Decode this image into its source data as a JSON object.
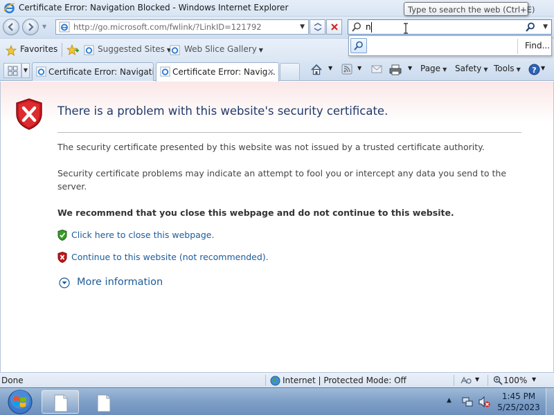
{
  "window": {
    "title": "Certificate Error: Navigation Blocked - Windows Internet Explorer"
  },
  "nav": {
    "url": "http://go.microsoft.com/fwlink/?LinkID=121792"
  },
  "search": {
    "value": "n",
    "tooltip": "Type to search the web (Ctrl+E)",
    "find_label": "Find..."
  },
  "favorites_bar": {
    "favorites_label": "Favorites",
    "suggested_sites": "Suggested Sites",
    "web_slice_gallery": "Web Slice Gallery"
  },
  "tabs": [
    {
      "label": "Certificate Error: Navigatio...",
      "active": false
    },
    {
      "label": "Certificate Error: Navig...",
      "active": true
    }
  ],
  "command_bar": {
    "page": "Page",
    "safety": "Safety",
    "tools": "Tools"
  },
  "content": {
    "heading": "There is a problem with this website's security certificate.",
    "para1": "The security certificate presented by this website was not issued by a trusted certificate authority.",
    "para2": "Security certificate problems may indicate an attempt to fool you or intercept any data you send to the server.",
    "recommendation": "We recommend that you close this webpage and do not continue to this website.",
    "close_link": "Click here to close this webpage.",
    "continue_link": "Continue to this website (not recommended).",
    "more_info": "More information"
  },
  "status_bar": {
    "status": "Done",
    "zone": "Internet | Protected Mode: Off",
    "zoom": "100%"
  },
  "taskbar": {
    "time": "1:45 PM",
    "date": "5/25/2023"
  },
  "colors": {
    "heading": "#1f3a6b",
    "link": "#1c5a99",
    "error_red": "#c4161c",
    "safe_green": "#3a9a2a"
  }
}
